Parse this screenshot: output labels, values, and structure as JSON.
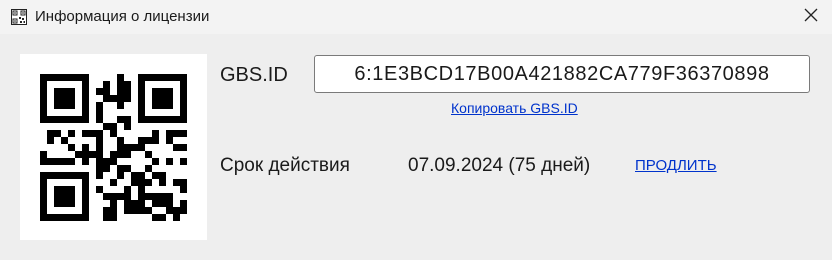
{
  "window": {
    "title": "Информация о лицензии",
    "app_icon": "qr-app-icon",
    "close_icon": "close-icon"
  },
  "license": {
    "qr_icon": "qr-code-icon",
    "gbs_id_label": "GBS.ID",
    "gbs_id_value": "6:1E3BCD17B00A421882CA779F36370898",
    "copy_link": "Копировать GBS.ID",
    "validity_label": "Срок действия",
    "validity_value": "07.09.2024 (75 дней)",
    "renew_link": "ПРОДЛИТЬ"
  },
  "colors": {
    "link": "#0033cc",
    "text": "#1a1a1a",
    "background": "#eeeeee",
    "titlebar": "#f3f3f3"
  }
}
